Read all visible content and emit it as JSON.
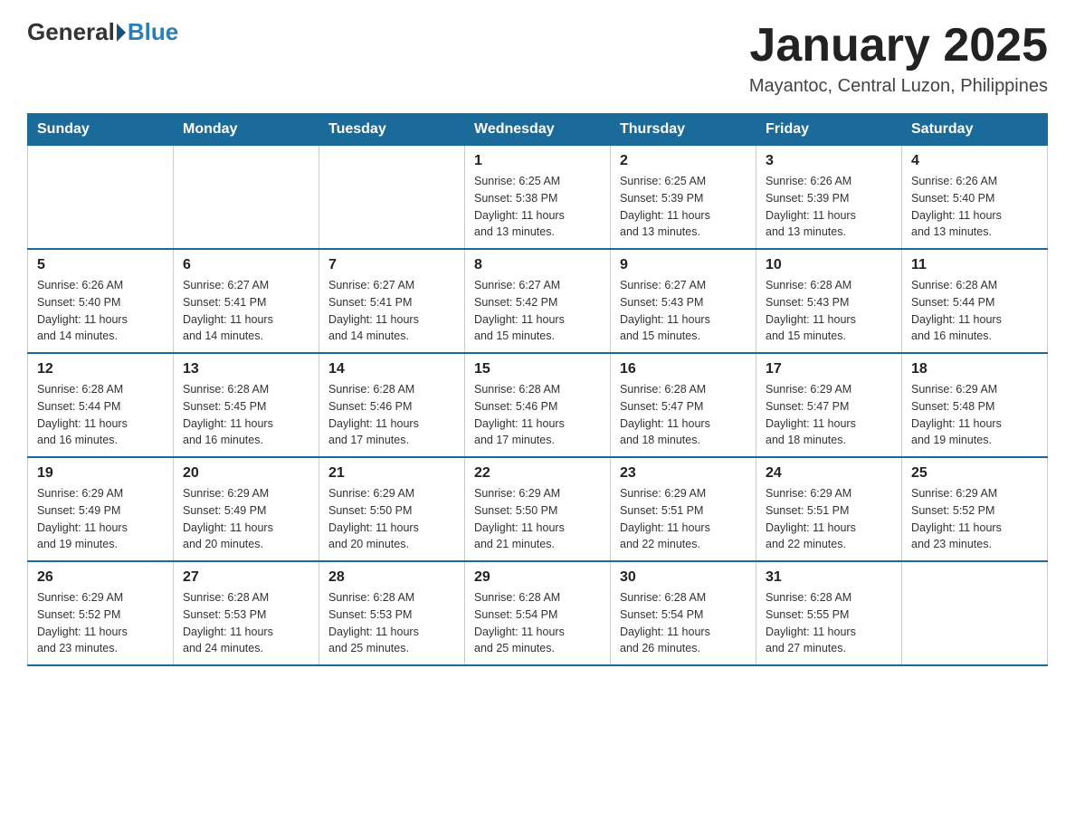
{
  "logo": {
    "general": "General",
    "blue": "Blue"
  },
  "title": "January 2025",
  "subtitle": "Mayantoc, Central Luzon, Philippines",
  "headers": [
    "Sunday",
    "Monday",
    "Tuesday",
    "Wednesday",
    "Thursday",
    "Friday",
    "Saturday"
  ],
  "weeks": [
    [
      {
        "day": "",
        "info": ""
      },
      {
        "day": "",
        "info": ""
      },
      {
        "day": "",
        "info": ""
      },
      {
        "day": "1",
        "info": "Sunrise: 6:25 AM\nSunset: 5:38 PM\nDaylight: 11 hours\nand 13 minutes."
      },
      {
        "day": "2",
        "info": "Sunrise: 6:25 AM\nSunset: 5:39 PM\nDaylight: 11 hours\nand 13 minutes."
      },
      {
        "day": "3",
        "info": "Sunrise: 6:26 AM\nSunset: 5:39 PM\nDaylight: 11 hours\nand 13 minutes."
      },
      {
        "day": "4",
        "info": "Sunrise: 6:26 AM\nSunset: 5:40 PM\nDaylight: 11 hours\nand 13 minutes."
      }
    ],
    [
      {
        "day": "5",
        "info": "Sunrise: 6:26 AM\nSunset: 5:40 PM\nDaylight: 11 hours\nand 14 minutes."
      },
      {
        "day": "6",
        "info": "Sunrise: 6:27 AM\nSunset: 5:41 PM\nDaylight: 11 hours\nand 14 minutes."
      },
      {
        "day": "7",
        "info": "Sunrise: 6:27 AM\nSunset: 5:41 PM\nDaylight: 11 hours\nand 14 minutes."
      },
      {
        "day": "8",
        "info": "Sunrise: 6:27 AM\nSunset: 5:42 PM\nDaylight: 11 hours\nand 15 minutes."
      },
      {
        "day": "9",
        "info": "Sunrise: 6:27 AM\nSunset: 5:43 PM\nDaylight: 11 hours\nand 15 minutes."
      },
      {
        "day": "10",
        "info": "Sunrise: 6:28 AM\nSunset: 5:43 PM\nDaylight: 11 hours\nand 15 minutes."
      },
      {
        "day": "11",
        "info": "Sunrise: 6:28 AM\nSunset: 5:44 PM\nDaylight: 11 hours\nand 16 minutes."
      }
    ],
    [
      {
        "day": "12",
        "info": "Sunrise: 6:28 AM\nSunset: 5:44 PM\nDaylight: 11 hours\nand 16 minutes."
      },
      {
        "day": "13",
        "info": "Sunrise: 6:28 AM\nSunset: 5:45 PM\nDaylight: 11 hours\nand 16 minutes."
      },
      {
        "day": "14",
        "info": "Sunrise: 6:28 AM\nSunset: 5:46 PM\nDaylight: 11 hours\nand 17 minutes."
      },
      {
        "day": "15",
        "info": "Sunrise: 6:28 AM\nSunset: 5:46 PM\nDaylight: 11 hours\nand 17 minutes."
      },
      {
        "day": "16",
        "info": "Sunrise: 6:28 AM\nSunset: 5:47 PM\nDaylight: 11 hours\nand 18 minutes."
      },
      {
        "day": "17",
        "info": "Sunrise: 6:29 AM\nSunset: 5:47 PM\nDaylight: 11 hours\nand 18 minutes."
      },
      {
        "day": "18",
        "info": "Sunrise: 6:29 AM\nSunset: 5:48 PM\nDaylight: 11 hours\nand 19 minutes."
      }
    ],
    [
      {
        "day": "19",
        "info": "Sunrise: 6:29 AM\nSunset: 5:49 PM\nDaylight: 11 hours\nand 19 minutes."
      },
      {
        "day": "20",
        "info": "Sunrise: 6:29 AM\nSunset: 5:49 PM\nDaylight: 11 hours\nand 20 minutes."
      },
      {
        "day": "21",
        "info": "Sunrise: 6:29 AM\nSunset: 5:50 PM\nDaylight: 11 hours\nand 20 minutes."
      },
      {
        "day": "22",
        "info": "Sunrise: 6:29 AM\nSunset: 5:50 PM\nDaylight: 11 hours\nand 21 minutes."
      },
      {
        "day": "23",
        "info": "Sunrise: 6:29 AM\nSunset: 5:51 PM\nDaylight: 11 hours\nand 22 minutes."
      },
      {
        "day": "24",
        "info": "Sunrise: 6:29 AM\nSunset: 5:51 PM\nDaylight: 11 hours\nand 22 minutes."
      },
      {
        "day": "25",
        "info": "Sunrise: 6:29 AM\nSunset: 5:52 PM\nDaylight: 11 hours\nand 23 minutes."
      }
    ],
    [
      {
        "day": "26",
        "info": "Sunrise: 6:29 AM\nSunset: 5:52 PM\nDaylight: 11 hours\nand 23 minutes."
      },
      {
        "day": "27",
        "info": "Sunrise: 6:28 AM\nSunset: 5:53 PM\nDaylight: 11 hours\nand 24 minutes."
      },
      {
        "day": "28",
        "info": "Sunrise: 6:28 AM\nSunset: 5:53 PM\nDaylight: 11 hours\nand 25 minutes."
      },
      {
        "day": "29",
        "info": "Sunrise: 6:28 AM\nSunset: 5:54 PM\nDaylight: 11 hours\nand 25 minutes."
      },
      {
        "day": "30",
        "info": "Sunrise: 6:28 AM\nSunset: 5:54 PM\nDaylight: 11 hours\nand 26 minutes."
      },
      {
        "day": "31",
        "info": "Sunrise: 6:28 AM\nSunset: 5:55 PM\nDaylight: 11 hours\nand 27 minutes."
      },
      {
        "day": "",
        "info": ""
      }
    ]
  ]
}
